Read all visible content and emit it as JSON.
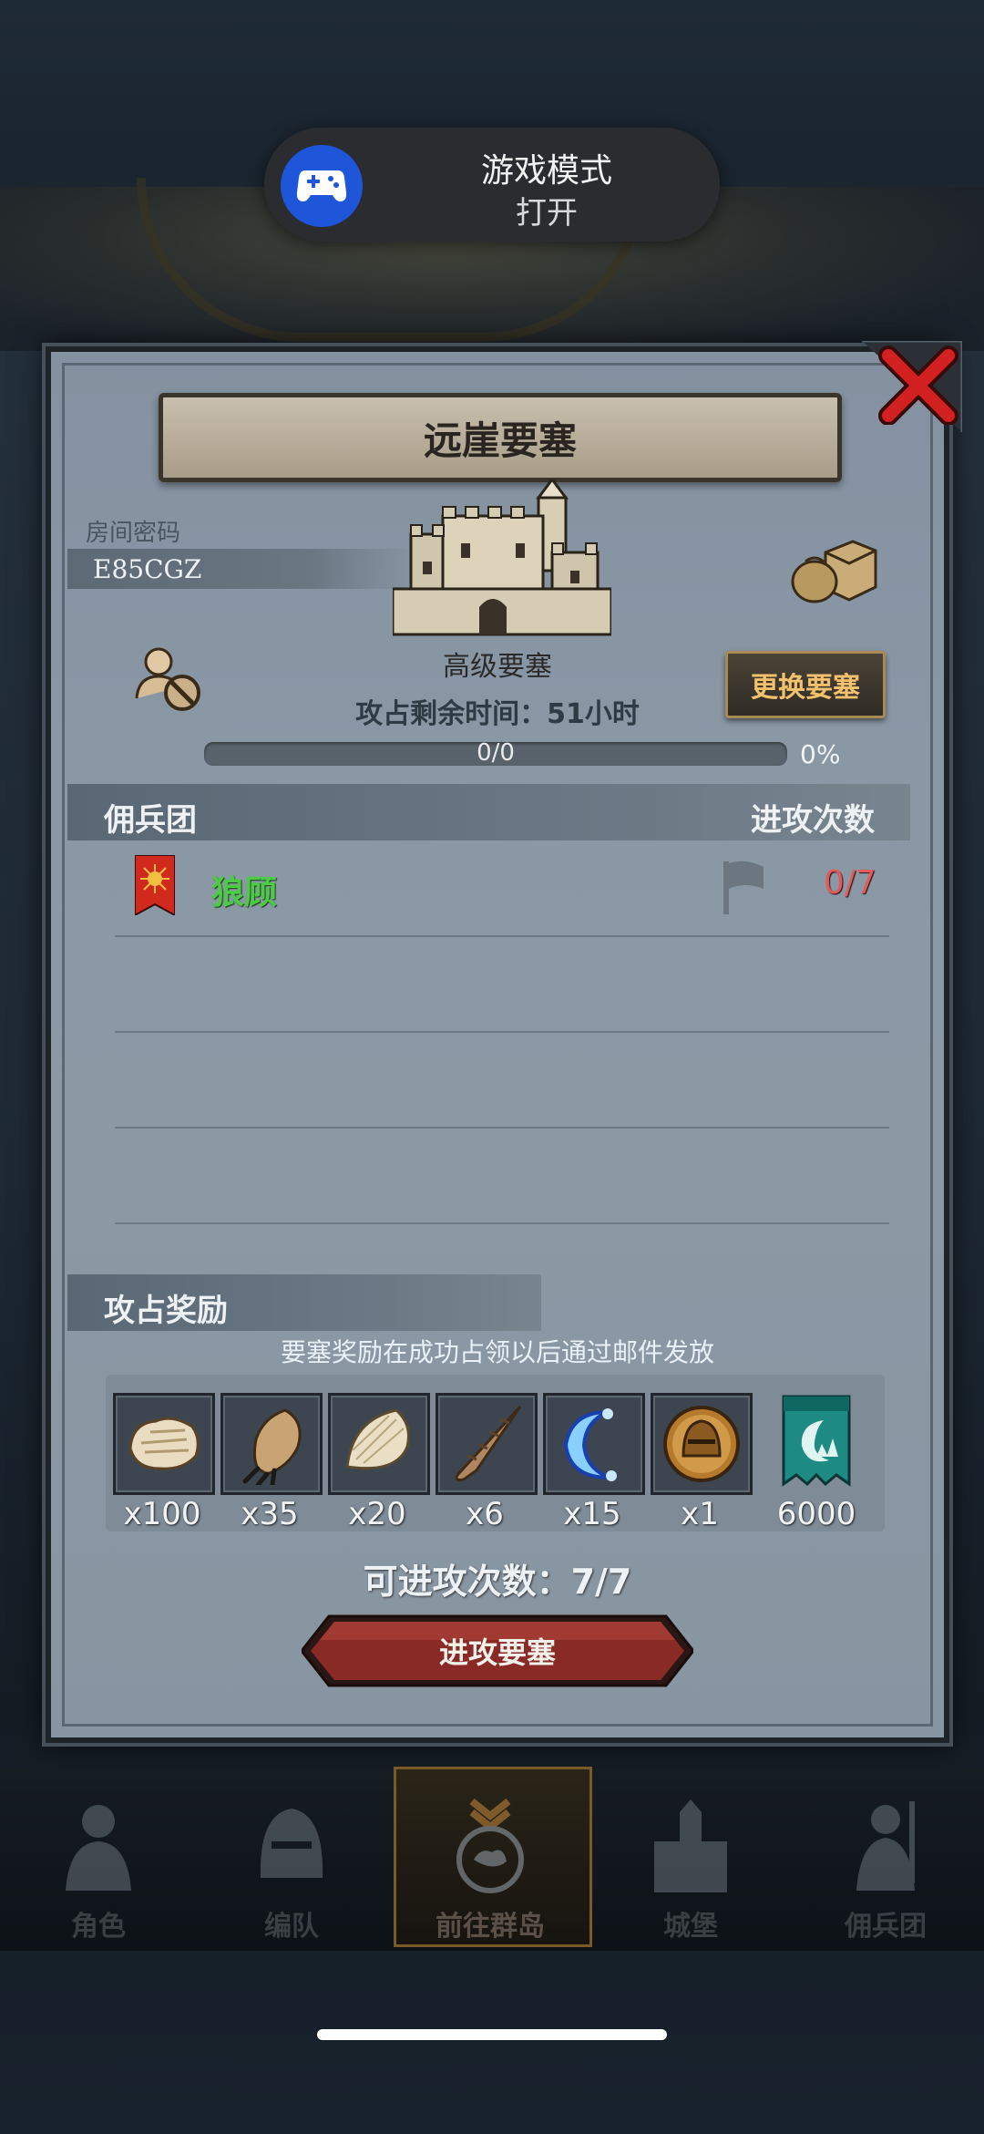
{
  "system_toast": {
    "title": "游戏模式",
    "subtitle": "打开",
    "icon": "gamepad-icon"
  },
  "modal": {
    "title": "远崖要塞",
    "room_label": "房间密码",
    "room_code": "E85CGZ",
    "fortress_level": "高级要塞",
    "change_button": "更换要塞",
    "time_left": "攻占剩余时间：51小时",
    "progress": {
      "text": "0/0",
      "percent_label": "0%",
      "fraction": 0
    },
    "mercenary_header": "佣兵团",
    "attack_count_header": "进攻次数",
    "mercenaries": [
      {
        "name": "狼顾",
        "attacks": "0/7"
      }
    ],
    "reward_header": "攻占奖励",
    "reward_note": "要塞奖励在成功占领以后通过邮件发放",
    "rewards": [
      {
        "icon": "fur-pelt-icon",
        "count": "x100"
      },
      {
        "icon": "claw-icon",
        "count": "x35"
      },
      {
        "icon": "scale-icon",
        "count": "x20"
      },
      {
        "icon": "horn-icon",
        "count": "x6"
      },
      {
        "icon": "crescent-rune-icon",
        "count": "x15"
      },
      {
        "icon": "helmet-medal-icon",
        "count": "x1"
      },
      {
        "icon": "guild-banner-icon",
        "count": "6000"
      }
    ],
    "attacks_available": "可进攻次数：7/7",
    "attack_button": "进攻要塞"
  },
  "bottom_nav": [
    {
      "label": "角色",
      "icon": "knight-icon"
    },
    {
      "label": "编队",
      "icon": "helmet-icon"
    },
    {
      "label": "前往群岛",
      "icon": "island-compass-icon",
      "active": true
    },
    {
      "label": "城堡",
      "icon": "castle-icon"
    },
    {
      "label": "佣兵团",
      "icon": "soldier-icon"
    }
  ],
  "colors": {
    "accent_orange": "#f3c06c",
    "merc_green": "#4ecb46",
    "count_red": "#e25a5a",
    "toast_blue": "#1f56d9"
  }
}
